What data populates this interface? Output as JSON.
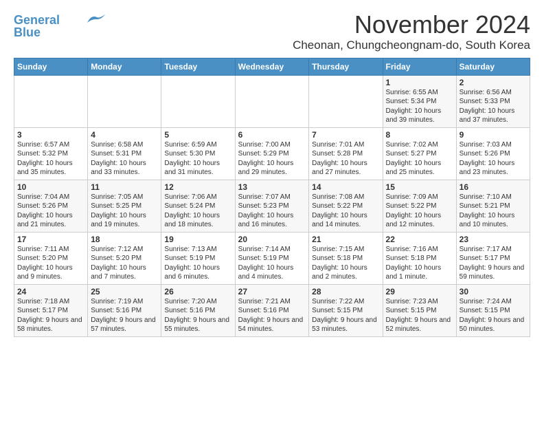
{
  "logo": {
    "line1": "General",
    "line2": "Blue"
  },
  "title": "November 2024",
  "location": "Cheonan, Chungcheongnam-do, South Korea",
  "weekdays": [
    "Sunday",
    "Monday",
    "Tuesday",
    "Wednesday",
    "Thursday",
    "Friday",
    "Saturday"
  ],
  "weeks": [
    [
      {
        "day": "",
        "info": ""
      },
      {
        "day": "",
        "info": ""
      },
      {
        "day": "",
        "info": ""
      },
      {
        "day": "",
        "info": ""
      },
      {
        "day": "",
        "info": ""
      },
      {
        "day": "1",
        "info": "Sunrise: 6:55 AM\nSunset: 5:34 PM\nDaylight: 10 hours and 39 minutes."
      },
      {
        "day": "2",
        "info": "Sunrise: 6:56 AM\nSunset: 5:33 PM\nDaylight: 10 hours and 37 minutes."
      }
    ],
    [
      {
        "day": "3",
        "info": "Sunrise: 6:57 AM\nSunset: 5:32 PM\nDaylight: 10 hours and 35 minutes."
      },
      {
        "day": "4",
        "info": "Sunrise: 6:58 AM\nSunset: 5:31 PM\nDaylight: 10 hours and 33 minutes."
      },
      {
        "day": "5",
        "info": "Sunrise: 6:59 AM\nSunset: 5:30 PM\nDaylight: 10 hours and 31 minutes."
      },
      {
        "day": "6",
        "info": "Sunrise: 7:00 AM\nSunset: 5:29 PM\nDaylight: 10 hours and 29 minutes."
      },
      {
        "day": "7",
        "info": "Sunrise: 7:01 AM\nSunset: 5:28 PM\nDaylight: 10 hours and 27 minutes."
      },
      {
        "day": "8",
        "info": "Sunrise: 7:02 AM\nSunset: 5:27 PM\nDaylight: 10 hours and 25 minutes."
      },
      {
        "day": "9",
        "info": "Sunrise: 7:03 AM\nSunset: 5:26 PM\nDaylight: 10 hours and 23 minutes."
      }
    ],
    [
      {
        "day": "10",
        "info": "Sunrise: 7:04 AM\nSunset: 5:26 PM\nDaylight: 10 hours and 21 minutes."
      },
      {
        "day": "11",
        "info": "Sunrise: 7:05 AM\nSunset: 5:25 PM\nDaylight: 10 hours and 19 minutes."
      },
      {
        "day": "12",
        "info": "Sunrise: 7:06 AM\nSunset: 5:24 PM\nDaylight: 10 hours and 18 minutes."
      },
      {
        "day": "13",
        "info": "Sunrise: 7:07 AM\nSunset: 5:23 PM\nDaylight: 10 hours and 16 minutes."
      },
      {
        "day": "14",
        "info": "Sunrise: 7:08 AM\nSunset: 5:22 PM\nDaylight: 10 hours and 14 minutes."
      },
      {
        "day": "15",
        "info": "Sunrise: 7:09 AM\nSunset: 5:22 PM\nDaylight: 10 hours and 12 minutes."
      },
      {
        "day": "16",
        "info": "Sunrise: 7:10 AM\nSunset: 5:21 PM\nDaylight: 10 hours and 10 minutes."
      }
    ],
    [
      {
        "day": "17",
        "info": "Sunrise: 7:11 AM\nSunset: 5:20 PM\nDaylight: 10 hours and 9 minutes."
      },
      {
        "day": "18",
        "info": "Sunrise: 7:12 AM\nSunset: 5:20 PM\nDaylight: 10 hours and 7 minutes."
      },
      {
        "day": "19",
        "info": "Sunrise: 7:13 AM\nSunset: 5:19 PM\nDaylight: 10 hours and 6 minutes."
      },
      {
        "day": "20",
        "info": "Sunrise: 7:14 AM\nSunset: 5:19 PM\nDaylight: 10 hours and 4 minutes."
      },
      {
        "day": "21",
        "info": "Sunrise: 7:15 AM\nSunset: 5:18 PM\nDaylight: 10 hours and 2 minutes."
      },
      {
        "day": "22",
        "info": "Sunrise: 7:16 AM\nSunset: 5:18 PM\nDaylight: 10 hours and 1 minute."
      },
      {
        "day": "23",
        "info": "Sunrise: 7:17 AM\nSunset: 5:17 PM\nDaylight: 9 hours and 59 minutes."
      }
    ],
    [
      {
        "day": "24",
        "info": "Sunrise: 7:18 AM\nSunset: 5:17 PM\nDaylight: 9 hours and 58 minutes."
      },
      {
        "day": "25",
        "info": "Sunrise: 7:19 AM\nSunset: 5:16 PM\nDaylight: 9 hours and 57 minutes."
      },
      {
        "day": "26",
        "info": "Sunrise: 7:20 AM\nSunset: 5:16 PM\nDaylight: 9 hours and 55 minutes."
      },
      {
        "day": "27",
        "info": "Sunrise: 7:21 AM\nSunset: 5:16 PM\nDaylight: 9 hours and 54 minutes."
      },
      {
        "day": "28",
        "info": "Sunrise: 7:22 AM\nSunset: 5:15 PM\nDaylight: 9 hours and 53 minutes."
      },
      {
        "day": "29",
        "info": "Sunrise: 7:23 AM\nSunset: 5:15 PM\nDaylight: 9 hours and 52 minutes."
      },
      {
        "day": "30",
        "info": "Sunrise: 7:24 AM\nSunset: 5:15 PM\nDaylight: 9 hours and 50 minutes."
      }
    ]
  ]
}
